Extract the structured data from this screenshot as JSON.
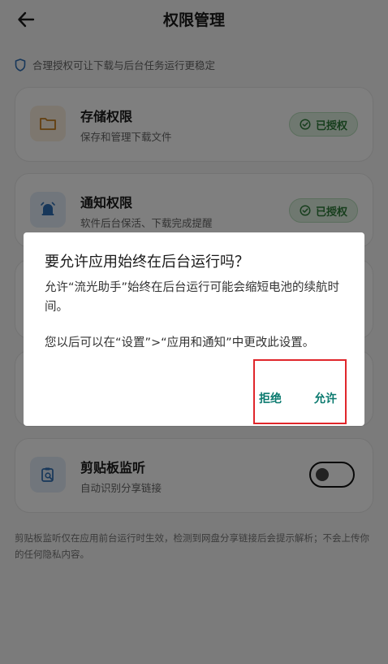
{
  "header": {
    "title": "权限管理"
  },
  "tip": {
    "text": "合理授权可让下载与后台任务运行更稳定"
  },
  "cards": [
    {
      "title": "存储权限",
      "subtitle": "保存和管理下载文件",
      "badge": "已授权"
    },
    {
      "title": "通知权限",
      "subtitle": "软件后台保活、下载完成提醒",
      "badge": "已授权"
    },
    {
      "title": "剪贴板监听",
      "subtitle": "自动识别分享链接",
      "toggle_on": false
    }
  ],
  "footnote": "剪贴板监听仅在应用前台运行时生效，检测到网盘分享链接后会提示解析；不会上传你的任何隐私内容。",
  "dialog": {
    "title": "要允许应用始终在后台运行吗？",
    "message": "允许“流光助手”始终在后台运行可能会缩短电池的续航时间。",
    "message2": "您以后可以在“设置”>“应用和通知”中更改此设置。",
    "deny_label": "拒绝",
    "allow_label": "允许"
  },
  "colors": {
    "accent": "#0b7a6f",
    "badge_green": "#2e7d3a",
    "highlight": "#e0262b"
  }
}
